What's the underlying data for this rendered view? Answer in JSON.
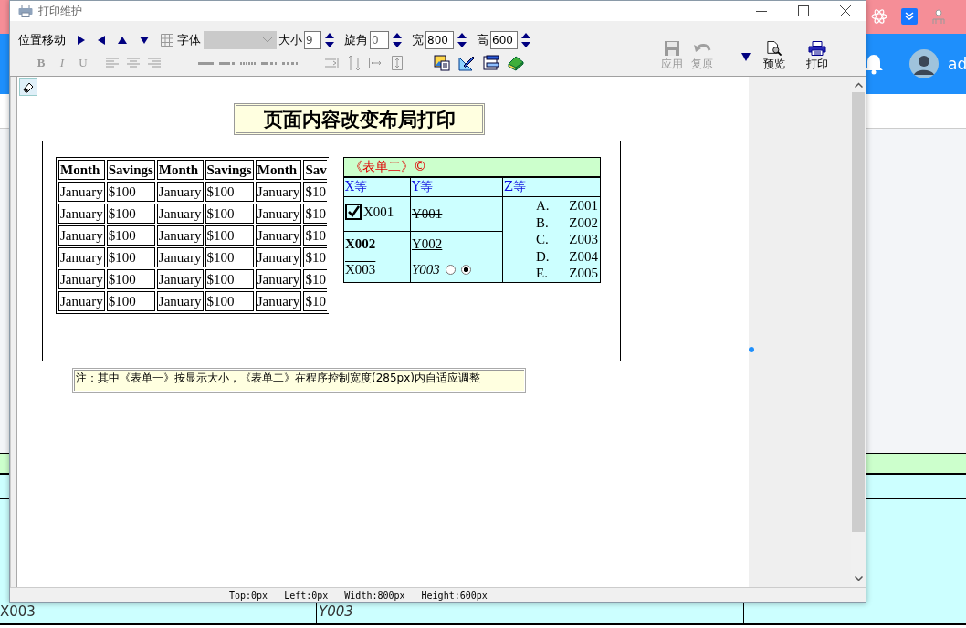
{
  "window": {
    "title": "打印维护"
  },
  "toolbar": {
    "move_label": "位置移动",
    "font": {
      "label": "字体",
      "disabled": true
    },
    "size": {
      "label": "大小",
      "value": "9"
    },
    "rotation": {
      "label": "旋角",
      "value": "0"
    },
    "width": {
      "label": "宽",
      "value": "800"
    },
    "height": {
      "label": "高",
      "value": "600"
    },
    "format_buttons": [
      {
        "label": "B",
        "disabled": true
      },
      {
        "label": "I",
        "disabled": true
      },
      {
        "label": "U",
        "disabled": true
      }
    ],
    "actions": [
      {
        "kind": "save",
        "label": "应用",
        "disabled": true
      },
      {
        "kind": "undo",
        "label": "复原",
        "disabled": true
      },
      {
        "kind": "preview",
        "label": "预览",
        "disabled": false
      },
      {
        "kind": "print",
        "label": "打印",
        "disabled": false
      }
    ]
  },
  "canvas": {
    "title": "页面内容改变布局打印",
    "table_one": {
      "columns": [
        "Month",
        "Savings",
        "Month",
        "Savings",
        "Month",
        "Sav"
      ],
      "rows": [
        [
          "January",
          "$100",
          "January",
          "$100",
          "January",
          "$10"
        ],
        [
          "January",
          "$100",
          "January",
          "$100",
          "January",
          "$10"
        ],
        [
          "January",
          "$100",
          "January",
          "$100",
          "January",
          "$10"
        ],
        [
          "January",
          "$100",
          "January",
          "$100",
          "January",
          "$10"
        ],
        [
          "January",
          "$100",
          "January",
          "$100",
          "January",
          "$10"
        ],
        [
          "January",
          "$100",
          "January",
          "$100",
          "January",
          "$10"
        ]
      ]
    },
    "table_two": {
      "caption": "《表单二》©",
      "headers": [
        "X等",
        "Y等",
        "Z等"
      ],
      "rows": [
        {
          "x": {
            "kind": "checkbox",
            "text": "X001",
            "checked": true
          },
          "y": {
            "kind": "strike",
            "text": "Y001"
          }
        },
        {
          "x": {
            "kind": "bold",
            "text": "X002"
          },
          "y": {
            "kind": "underline",
            "text": "Y002"
          }
        },
        {
          "x": {
            "kind": "overline",
            "text": "X003"
          },
          "y": {
            "kind": "italic",
            "text": "Y003",
            "radios": [
              {
                "selected": false
              },
              {
                "selected": true
              }
            ]
          }
        }
      ],
      "z_items": [
        {
          "marker": "A.",
          "text": "Z001"
        },
        {
          "marker": "B.",
          "text": "Z002"
        },
        {
          "marker": "C.",
          "text": "Z003"
        },
        {
          "marker": "D.",
          "text": "Z004"
        },
        {
          "marker": "E.",
          "text": "Z005"
        }
      ]
    },
    "note": "注：其中《表单一》按显示大小，《表单二》在程序控制宽度(285px)内自适应调整"
  },
  "status_bar": [
    "Top:0px",
    "Left:0px",
    "Width:800px",
    "Height:600px"
  ],
  "background": {
    "user": "ad",
    "cells": [
      "X003",
      "Y003"
    ]
  }
}
